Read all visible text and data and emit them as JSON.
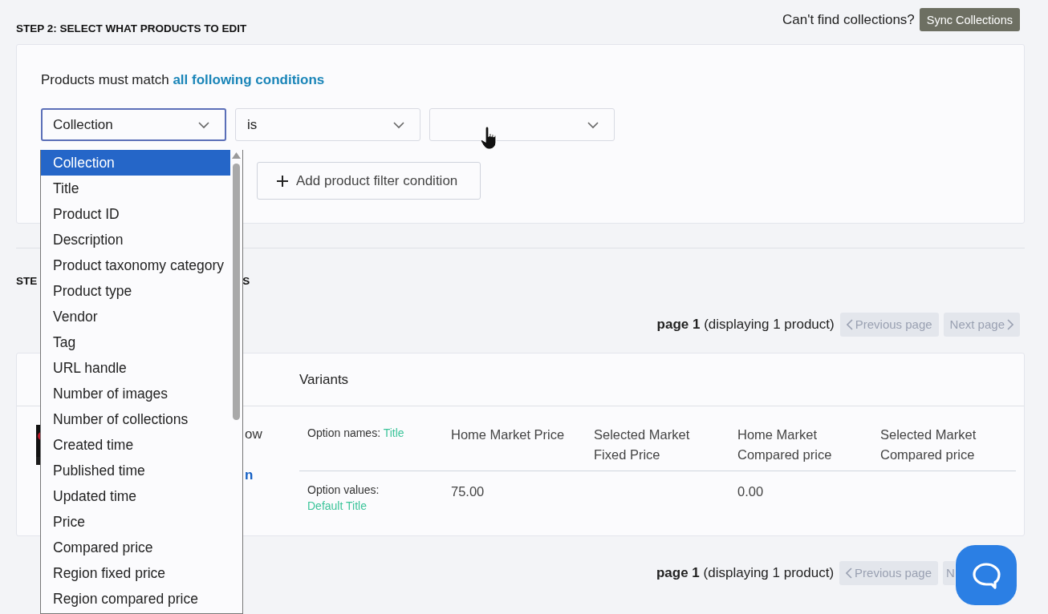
{
  "step2": {
    "heading": "STEP 2: SELECT WHAT PRODUCTS TO EDIT",
    "sync_hint": "Can't find collections?",
    "sync_button": "Sync Collections"
  },
  "filter": {
    "intro": "Products must match",
    "match_link": "all following conditions",
    "conditions": [
      {
        "value": "Collection",
        "focused": true
      },
      {
        "value": "is",
        "focused": false
      },
      {
        "focused": false
      }
    ],
    "add_button": "Add product filter condition"
  },
  "step3": {
    "heading_start": "STE",
    "heading_end": "S"
  },
  "pagers": [
    {
      "page": "page 1",
      "summary": "(displaying 1 product)",
      "buttons": [
        {
          "label": "Previous page",
          "kind": "prev",
          "disabled": true
        },
        {
          "label": "Next page",
          "kind": "next",
          "disabled": true
        }
      ]
    },
    {
      "page": "page 1",
      "summary": "(displaying 1 product)",
      "buttons": [
        {
          "label": "Previous page",
          "kind": "prev",
          "disabled": true
        },
        {
          "label": "N",
          "kind": "next",
          "disabled": true
        }
      ]
    }
  ],
  "product_table": {
    "header": "Variants",
    "product_title_fragment": "ow",
    "product_link_fragment": "n",
    "option_names_label": "Option names:",
    "option_names_value": "Title",
    "option_values_label": "Option values:",
    "option_values_value": "Default Title",
    "columns": [
      {
        "lines": [
          "Home Market Price"
        ]
      },
      {
        "lines": [
          "Selected Market",
          "Fixed Price"
        ]
      },
      {
        "lines": [
          "Home Market",
          "Compared price"
        ]
      },
      {
        "lines": [
          "Selected Market",
          "Compared price"
        ]
      }
    ],
    "cells": [
      {
        "text": "75.00"
      },
      {},
      {
        "text": "0.00"
      },
      {}
    ]
  },
  "dropdown": {
    "items": [
      {
        "label": "Collection",
        "selected": true
      },
      {
        "label": "Title",
        "selected": false
      },
      {
        "label": "Product ID",
        "selected": false
      },
      {
        "label": "Description",
        "selected": false
      },
      {
        "label": "Product taxonomy category",
        "selected": false
      },
      {
        "label": "Product type",
        "selected": false
      },
      {
        "label": "Vendor",
        "selected": false
      },
      {
        "label": "Tag",
        "selected": false
      },
      {
        "label": "URL handle",
        "selected": false
      },
      {
        "label": "Number of images",
        "selected": false
      },
      {
        "label": "Number of collections",
        "selected": false
      },
      {
        "label": "Created time",
        "selected": false
      },
      {
        "label": "Published time",
        "selected": false
      },
      {
        "label": "Updated time",
        "selected": false
      },
      {
        "label": "Price",
        "selected": false
      },
      {
        "label": "Compared price",
        "selected": false
      },
      {
        "label": "Region fixed price",
        "selected": false
      },
      {
        "label": "Region compared price",
        "selected": false
      }
    ]
  }
}
